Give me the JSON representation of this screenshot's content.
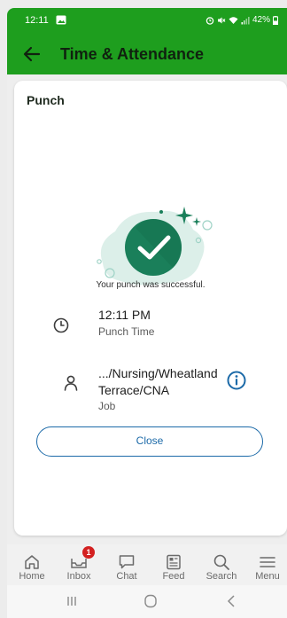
{
  "status_bar": {
    "time": "12:11",
    "battery": "42%",
    "icons": [
      "image-icon",
      "alarm-icon",
      "mute-icon",
      "wifi-icon",
      "signal-icon",
      "battery-icon"
    ]
  },
  "app_bar": {
    "title": "Time & Attendance",
    "back_icon": "arrow-left-icon"
  },
  "card": {
    "title": "Punch",
    "success_message": "Your punch was successful.",
    "rows": [
      {
        "icon": "clock-icon",
        "value": "12:11 PM",
        "label": "Punch Time"
      },
      {
        "icon": "person-icon",
        "value_line1": ".../Nursing/Wheatland",
        "value_line2": "Terrace/CNA",
        "label": "Job",
        "info_icon": "info-icon"
      }
    ],
    "close_label": "Close"
  },
  "bottom_nav": {
    "items": [
      {
        "label": "Home",
        "icon": "home-icon"
      },
      {
        "label": "Inbox",
        "icon": "inbox-icon",
        "badge": "1"
      },
      {
        "label": "Chat",
        "icon": "chat-icon"
      },
      {
        "label": "Feed",
        "icon": "feed-icon"
      },
      {
        "label": "Search",
        "icon": "search-icon"
      },
      {
        "label": "Menu",
        "icon": "menu-icon"
      }
    ]
  },
  "system_nav": {
    "buttons": [
      "recent-apps-icon",
      "home-circle-icon",
      "back-chevron-icon"
    ]
  },
  "colors": {
    "brand_green": "#1e9e1e",
    "success_teal": "#1a7f5a",
    "link_blue": "#1c6aa8",
    "badge_red": "#d32020"
  }
}
